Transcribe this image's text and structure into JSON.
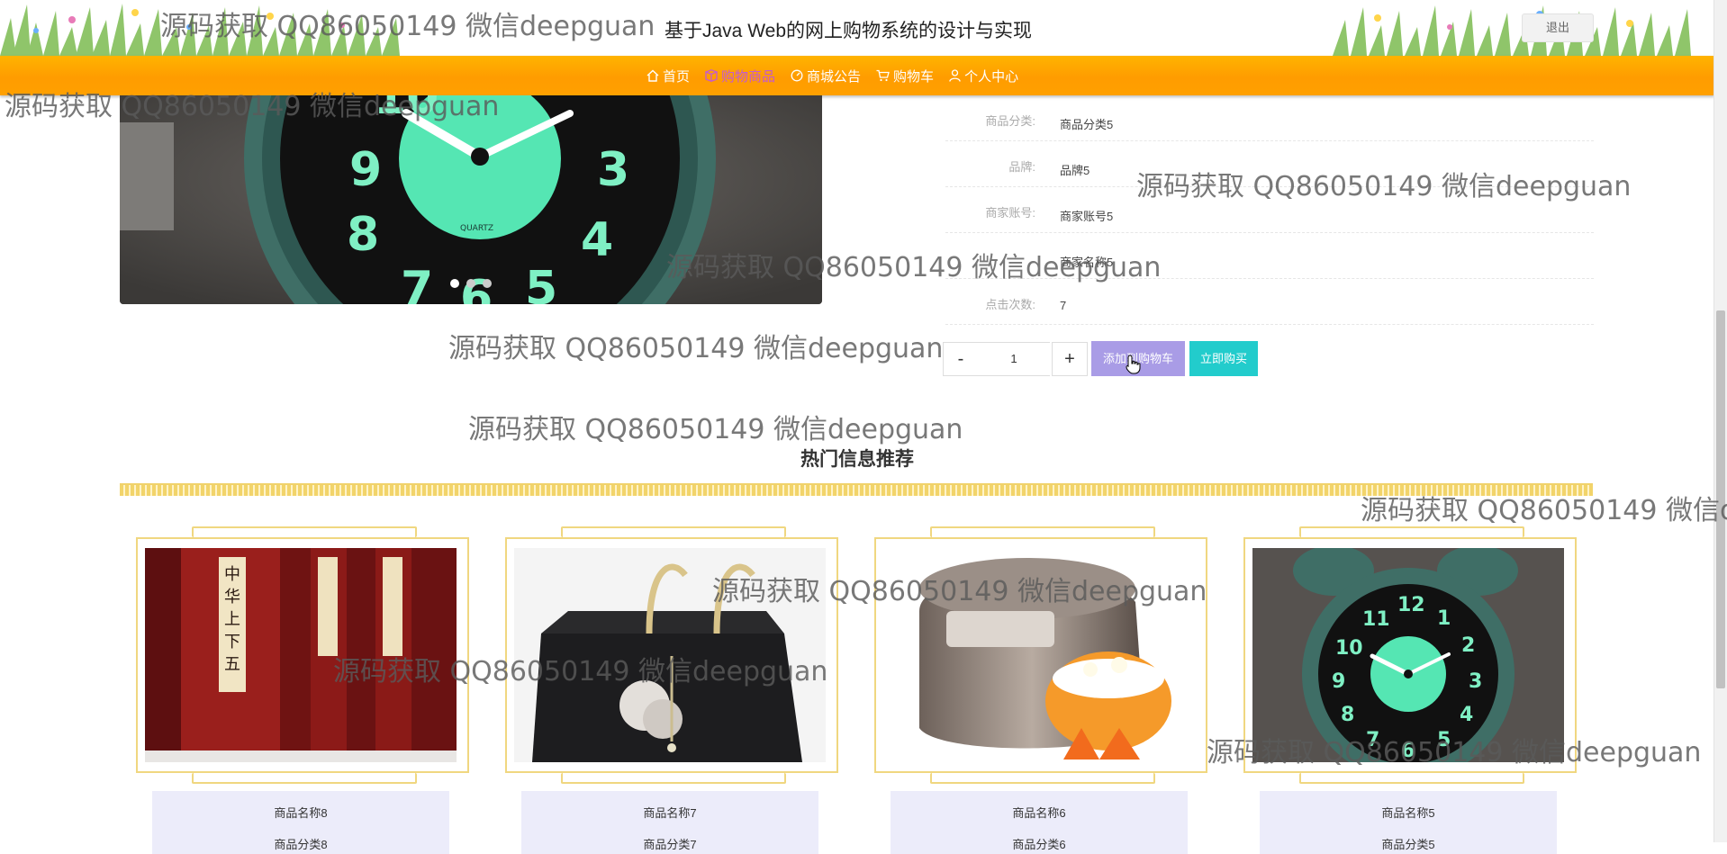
{
  "header": {
    "site_title": "基于Java Web的网上购物系统的设计与实现",
    "logout_label": "退出"
  },
  "nav": {
    "items": [
      {
        "label": "首页",
        "icon": "home-icon"
      },
      {
        "label": "购物商品",
        "icon": "gift-icon",
        "active": true
      },
      {
        "label": "商城公告",
        "icon": "speed-icon"
      },
      {
        "label": "购物车",
        "icon": "cart-icon"
      },
      {
        "label": "个人中心",
        "icon": "user-icon"
      }
    ]
  },
  "product": {
    "carousel_dots": 3,
    "carousel_active_index": 0,
    "details": [
      {
        "label": "商品分类:",
        "value": "商品分类5"
      },
      {
        "label": "品牌:",
        "value": "品牌5"
      },
      {
        "label": "商家账号:",
        "value": "商家账号5"
      },
      {
        "label": "",
        "value": "商家名称5"
      },
      {
        "label": "点击次数:",
        "value": "7"
      }
    ],
    "quantity": "1",
    "minus_label": "-",
    "plus_label": "+",
    "add_to_cart_label": "添加到购物车",
    "buy_now_label": "立即购买"
  },
  "hot": {
    "title": "热门信息推荐",
    "items": [
      {
        "name": "商品名称8",
        "category": "商品分类8"
      },
      {
        "name": "商品名称7",
        "category": "商品分类7"
      },
      {
        "name": "商品名称6",
        "category": "商品分类6"
      },
      {
        "name": "商品名称5",
        "category": "商品分类5"
      }
    ]
  },
  "watermark": {
    "text": "源码获取 QQ86050149 微信deepguan"
  },
  "colors": {
    "nav_gradient_top": "#ffb400",
    "nav_active": "#c45ad1",
    "cart_button": "#a99ce6",
    "buy_button": "#22cccc",
    "card_info_bg": "#ececfa",
    "zigzag": "#f2d46a"
  }
}
